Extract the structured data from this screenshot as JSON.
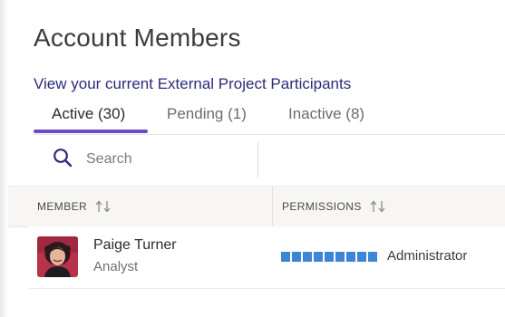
{
  "page": {
    "title": "Account Members",
    "external_link": "View your current External Project Participants"
  },
  "tabs": [
    {
      "label": "Active (30)",
      "active": true
    },
    {
      "label": "Pending (1)",
      "active": false
    },
    {
      "label": "Inactive (8)",
      "active": false
    }
  ],
  "search": {
    "placeholder": "Search",
    "value": ""
  },
  "table": {
    "columns": [
      {
        "label": "MEMBER",
        "sort_icon": "sort-arrows-icon"
      },
      {
        "label": "PERMISSIONS",
        "sort_icon": "sort-arrows-icon"
      }
    ],
    "rows": [
      {
        "name": "Paige Turner",
        "role": "Analyst",
        "permission_label": "Administrator",
        "permission_level": 1.0,
        "avatar_icon": "user-photo-avatar"
      }
    ]
  },
  "colors": {
    "accent": "#6a4dc4",
    "link": "#2b2a7a",
    "permission_bar": "#3d86d6",
    "header_bg": "#f7f6f5"
  }
}
